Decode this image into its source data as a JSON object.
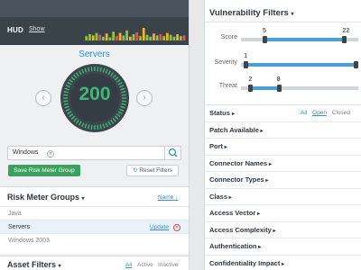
{
  "hud": {
    "title": "HUD",
    "show_link": "Show",
    "sparkline": [
      {
        "color": "#8ec63f",
        "value": 0.35
      },
      {
        "color": "#8ec63f",
        "value": 0.5
      },
      {
        "color": "#f0b429",
        "value": 0.4
      },
      {
        "color": "#8ec63f",
        "value": 0.6
      },
      {
        "color": "#e05555",
        "value": 0.45
      },
      {
        "color": "#8ec63f",
        "value": 0.3
      },
      {
        "color": "#f0b429",
        "value": 0.55
      },
      {
        "color": "#8ec63f",
        "value": 0.25
      },
      {
        "color": "#8ec63f",
        "value": 0.7
      },
      {
        "color": "#e05555",
        "value": 0.35
      },
      {
        "color": "#f0b429",
        "value": 0.6
      },
      {
        "color": "#8ec63f",
        "value": 0.4
      },
      {
        "color": "#8ec63f",
        "value": 0.8
      },
      {
        "color": "#f0b429",
        "value": 0.3
      },
      {
        "color": "#8ec63f",
        "value": 0.5
      },
      {
        "color": "#e05555",
        "value": 0.65
      },
      {
        "color": "#8ec63f",
        "value": 0.35
      },
      {
        "color": "#f0b429",
        "value": 1.0
      },
      {
        "color": "#8ec63f",
        "value": 0.45
      },
      {
        "color": "#8ec63f",
        "value": 0.3
      },
      {
        "color": "#f0b429",
        "value": 0.55
      },
      {
        "color": "#8ec63f",
        "value": 0.4
      },
      {
        "color": "#e05555",
        "value": 0.5
      },
      {
        "color": "#8ec63f",
        "value": 0.35
      },
      {
        "color": "#f0b429",
        "value": 0.6
      },
      {
        "color": "#8ec63f",
        "value": 0.45
      },
      {
        "color": "#8ec63f",
        "value": 0.3
      },
      {
        "color": "#f0b429",
        "value": 0.5
      },
      {
        "color": "#8ec63f",
        "value": 0.35
      },
      {
        "color": "#e05555",
        "value": 0.4
      }
    ]
  },
  "servers": {
    "title": "Servers",
    "value": "200",
    "gauge_color": "#3fb97a",
    "gauge_ring_color": "#3d454c"
  },
  "search": {
    "tag": "Windows",
    "icon": "search-icon",
    "save_button": "Save Risk Meter Group",
    "reset_button": "Reset Filters"
  },
  "risk_meter_groups": {
    "title": "Risk Meter Groups",
    "sort_label": "Name",
    "items": [
      {
        "label": "Java",
        "selected": false
      },
      {
        "label": "Servers",
        "selected": true,
        "update_label": "Update"
      },
      {
        "label": "Windows 2003",
        "selected": false
      }
    ]
  },
  "asset_filters": {
    "title": "Asset Filters",
    "tabs": [
      "All",
      "Active",
      "Inactive"
    ]
  },
  "vulnerability_filters": {
    "title": "Vulnerability Filters",
    "sliders": [
      {
        "label": "Score",
        "min": 0,
        "max": 25,
        "low": 5,
        "high": 22
      },
      {
        "label": "Severity",
        "min": 0,
        "max": 25,
        "low": 1,
        "high": 25,
        "low_label": "1"
      },
      {
        "label": "Threat",
        "min": 0,
        "max": 25,
        "low": 2,
        "high": 8
      }
    ],
    "status": {
      "label": "Status",
      "tabs": [
        "All",
        "Open",
        "Closed"
      ],
      "active_tab": "Open"
    },
    "filters": [
      "Patch Available",
      "Port",
      "Connector Names",
      "Connector Types",
      "Class",
      "Access Vector",
      "Access Complexity",
      "Authentication",
      "Confidentiality Impact"
    ],
    "accent": "#4a9fd4"
  }
}
